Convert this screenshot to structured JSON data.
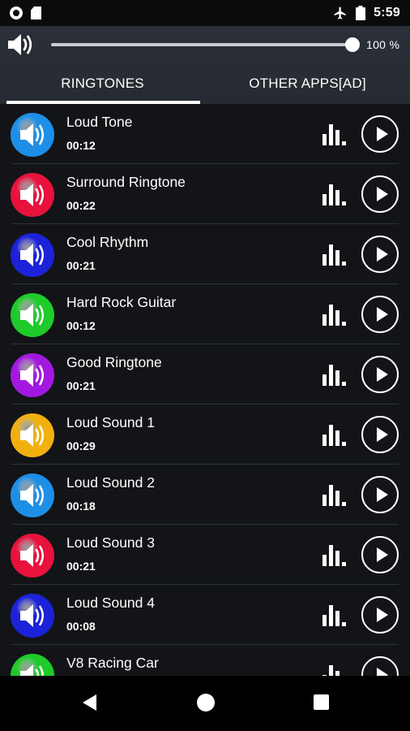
{
  "status_bar": {
    "time": "5:59",
    "icons": [
      "record-icon",
      "sd-card-icon",
      "airplane-mode-icon",
      "battery-icon"
    ]
  },
  "volume": {
    "percent_label": "100 %",
    "level": 1.0,
    "icon": "speaker-icon"
  },
  "tabs": [
    {
      "label": "RINGTONES",
      "active": true
    },
    {
      "label": "OTHER APPS[AD]",
      "active": false
    }
  ],
  "ringtones": [
    {
      "title": "Loud Tone",
      "duration": "00:12",
      "color": "#1e8fe6"
    },
    {
      "title": "Surround Ringtone",
      "duration": "00:22",
      "color": "#e8123c"
    },
    {
      "title": "Cool Rhythm",
      "duration": "00:21",
      "color": "#1c22d8"
    },
    {
      "title": "Hard Rock Guitar",
      "duration": "00:12",
      "color": "#1ecb2a"
    },
    {
      "title": "Good Ringtone",
      "duration": "00:21",
      "color": "#a318e0"
    },
    {
      "title": "Loud Sound 1",
      "duration": "00:29",
      "color": "#f2b010"
    },
    {
      "title": "Loud Sound 2",
      "duration": "00:18",
      "color": "#1e8fe6"
    },
    {
      "title": "Loud Sound 3",
      "duration": "00:21",
      "color": "#e8123c"
    },
    {
      "title": "Loud Sound 4",
      "duration": "00:08",
      "color": "#1c22d8"
    },
    {
      "title": "V8 Racing Car",
      "duration": "",
      "color": "#1ecb2a"
    }
  ],
  "nav_bar": {
    "icons": [
      "back-icon",
      "home-icon",
      "recents-icon"
    ]
  }
}
